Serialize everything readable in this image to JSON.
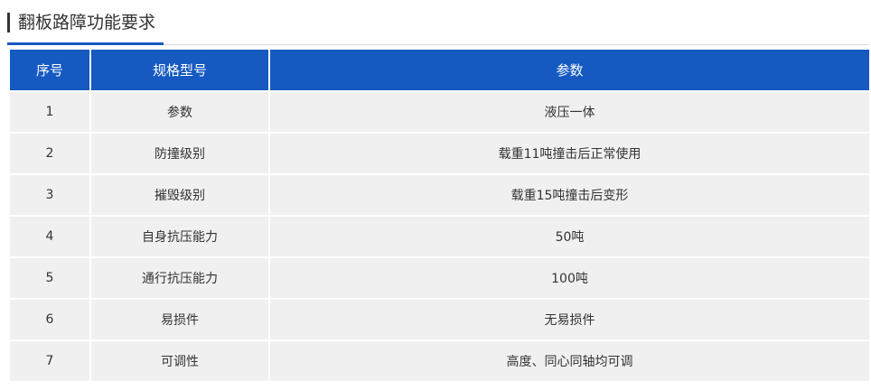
{
  "section": {
    "title": "翻板路障功能要求"
  },
  "colors": {
    "header_bg": "#1559c1",
    "header_text": "#ffffff",
    "row_bg": "#f0f0f0",
    "accent_underline": "#1557c0",
    "text": "#333333"
  },
  "table": {
    "headers": [
      "序号",
      "规格型号",
      "参数"
    ],
    "rows": [
      [
        "1",
        "参数",
        "液压一体"
      ],
      [
        "2",
        "防撞级别",
        "载重11吨撞击后正常使用"
      ],
      [
        "3",
        "摧毁级别",
        "载重15吨撞击后变形"
      ],
      [
        "4",
        "自身抗压能力",
        "50吨"
      ],
      [
        "5",
        "通行抗压能力",
        "100吨"
      ],
      [
        "6",
        "易损件",
        "无易损件"
      ],
      [
        "7",
        "可调性",
        "高度、同心同轴均可调"
      ]
    ]
  }
}
